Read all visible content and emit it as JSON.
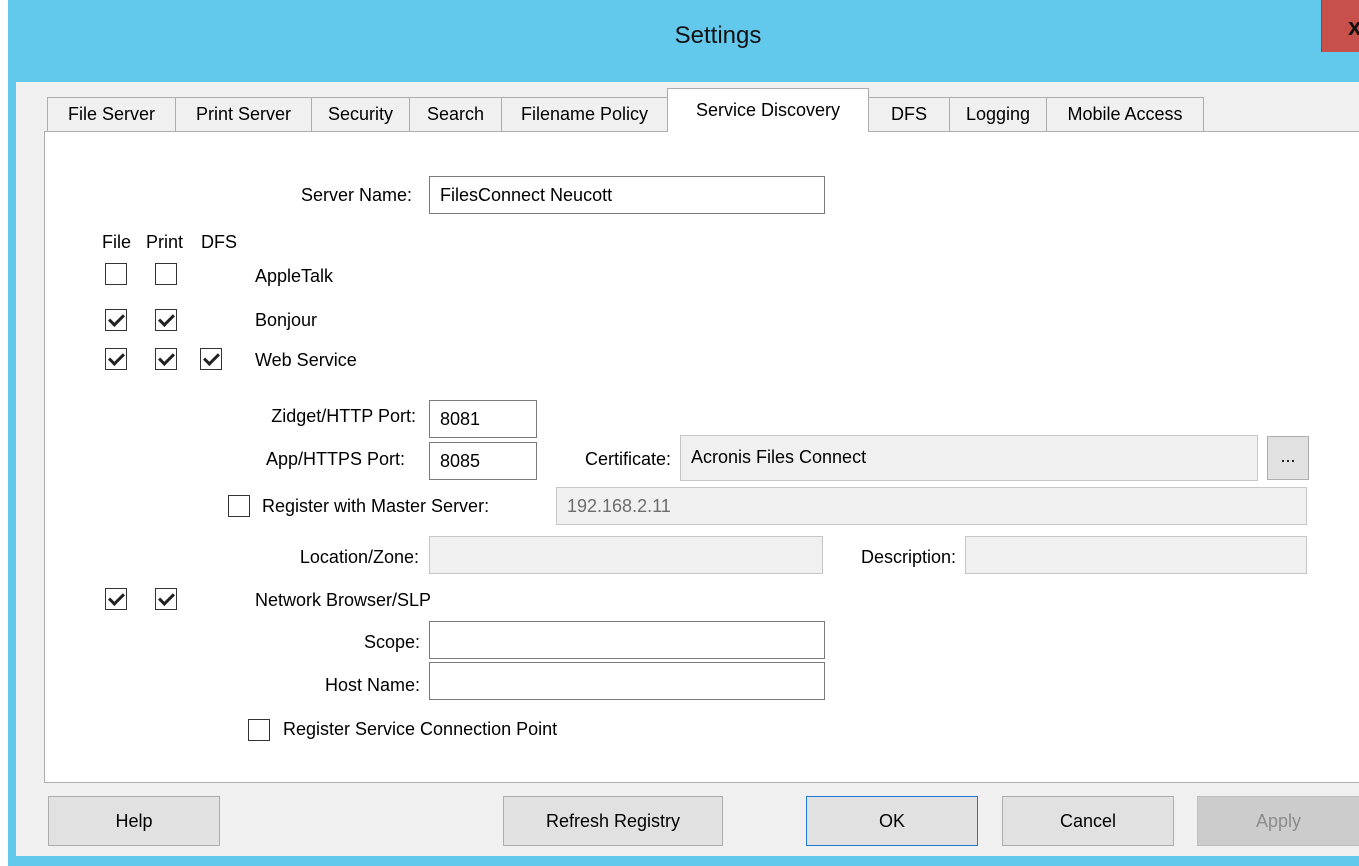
{
  "window": {
    "title": "Settings",
    "close_glyph": "x"
  },
  "tabs": [
    {
      "label": "File Server"
    },
    {
      "label": "Print Server"
    },
    {
      "label": "Security"
    },
    {
      "label": "Search"
    },
    {
      "label": "Filename Policy"
    },
    {
      "label": "Service Discovery",
      "active": true
    },
    {
      "label": "DFS"
    },
    {
      "label": "Logging"
    },
    {
      "label": "Mobile Access"
    }
  ],
  "form": {
    "server_name_label": "Server Name:",
    "server_name_value": "FilesConnect Neucott",
    "col_file": "File",
    "col_print": "Print",
    "col_dfs": "DFS",
    "appletalk": {
      "label": "AppleTalk",
      "file": false,
      "print": false
    },
    "bonjour": {
      "label": "Bonjour",
      "file": true,
      "print": true
    },
    "web_service": {
      "label": "Web Service",
      "file": true,
      "print": true,
      "dfs": true
    },
    "http_port_label": "Zidget/HTTP Port:",
    "http_port_value": "8081",
    "https_port_label": "App/HTTPS Port:",
    "https_port_value": "8085",
    "certificate_label": "Certificate:",
    "certificate_value": "Acronis Files Connect",
    "certificate_browse": "...",
    "register_master": {
      "label": "Register with Master Server:",
      "checked": false
    },
    "master_server_value": "192.168.2.11",
    "location_label": "Location/Zone:",
    "location_value": "",
    "description_label": "Description:",
    "description_value": "",
    "network_browser": {
      "label": "Network Browser/SLP",
      "file": true,
      "print": true
    },
    "scope_label": "Scope:",
    "scope_value": "",
    "host_name_label": "Host Name:",
    "host_name_value": "",
    "register_scp": {
      "label": "Register Service Connection Point",
      "checked": false
    }
  },
  "buttons": {
    "help": "Help",
    "refresh": "Refresh Registry",
    "ok": "OK",
    "cancel": "Cancel",
    "apply": "Apply"
  },
  "colors": {
    "titlebar": "#63c9ec",
    "close": "#c7504b",
    "default_button_border": "#1e7ad3"
  }
}
